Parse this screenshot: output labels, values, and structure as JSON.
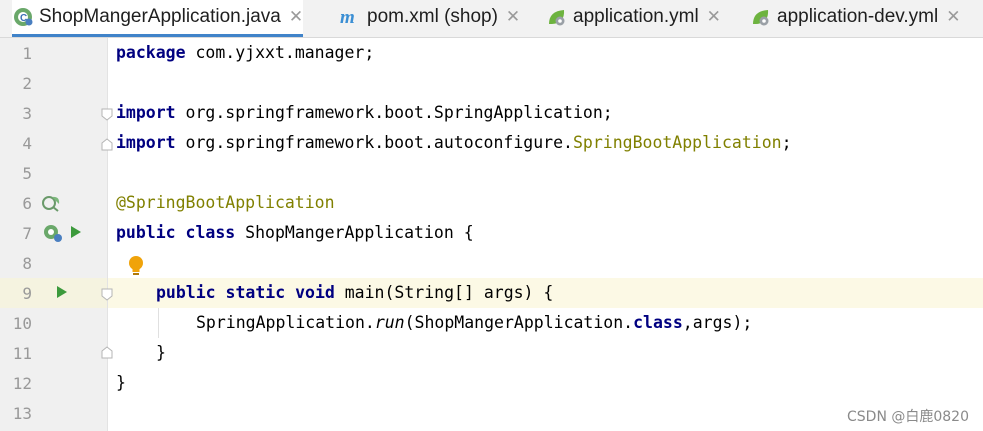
{
  "tabs": [
    {
      "label": "ShopMangerApplication.java",
      "icon": "spring-class-icon",
      "active": true
    },
    {
      "label": "pom.xml (shop)",
      "icon": "maven-icon",
      "active": false
    },
    {
      "label": "application.yml",
      "icon": "spring-config-icon",
      "active": false
    },
    {
      "label": "application-dev.yml",
      "icon": "spring-config-icon",
      "active": false
    }
  ],
  "editor": {
    "line_numbers": [
      "1",
      "2",
      "3",
      "4",
      "5",
      "6",
      "7",
      "8",
      "9",
      "10",
      "11",
      "12",
      "13"
    ],
    "lines": {
      "l1_kw": "package",
      "l1_rest": " com.yjxxt.manager;",
      "l3_kw": "import",
      "l3_rest": " org.springframework.boot.SpringApplication;",
      "l4_kw": "import",
      "l4_pkg": " org.springframework.boot.autoconfigure.",
      "l4_cls": "SpringBootApplication",
      "l4_end": ";",
      "l6_ann": "@SpringBootApplication",
      "l7_kw": "public class",
      "l7_rest": " ShopMangerApplication {",
      "l9_kw": "public static void",
      "l9_rest": " main(String[] args) {",
      "l10_a": "SpringApplication.",
      "l10_run": "run",
      "l10_b": "(ShopMangerApplication.",
      "l10_kw": "class",
      "l10_c": ",args);",
      "l11": "}",
      "l12": "}"
    }
  },
  "watermark": "CSDN @白鹿0820",
  "colors": {
    "keyword": "#000080",
    "annotation": "#808000",
    "tab_accent": "#4083c9",
    "run_green": "#3c9a3c",
    "bulb": "#f0a30a"
  }
}
